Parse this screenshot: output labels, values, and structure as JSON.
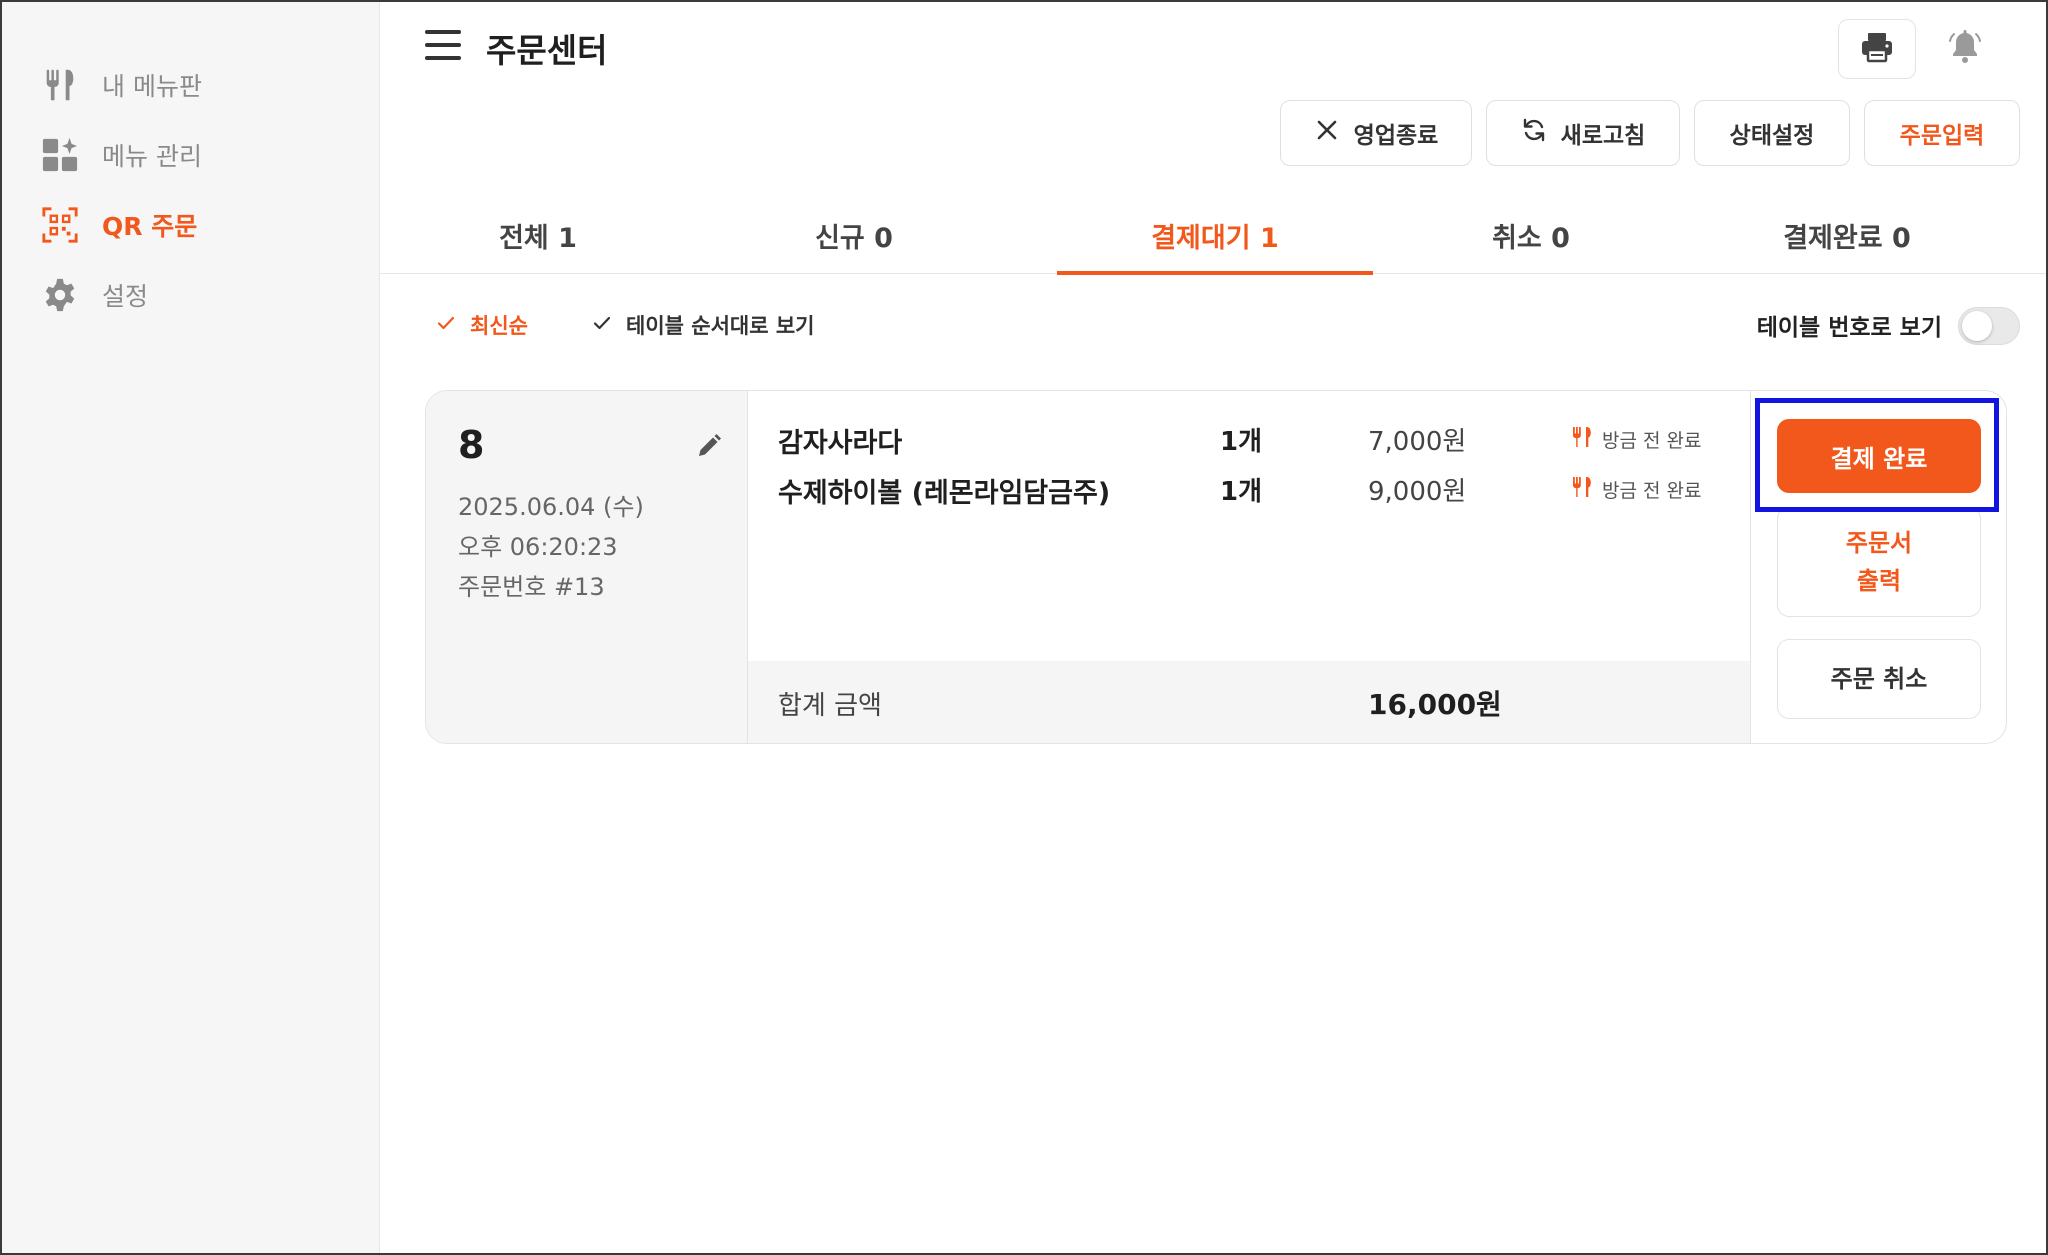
{
  "sidebar": {
    "items": [
      {
        "label": "내 메뉴판",
        "icon": "utensils-icon",
        "active": false
      },
      {
        "label": "메뉴 관리",
        "icon": "grid-sparkle-icon",
        "active": false
      },
      {
        "label": "QR 주문",
        "icon": "qr-scan-icon",
        "active": true
      },
      {
        "label": "설정",
        "icon": "gear-icon",
        "active": false
      }
    ]
  },
  "header": {
    "title": "주문센터",
    "menu_icon": "hamburger-icon",
    "print_icon": "printer-icon",
    "bell_icon": "bell-icon"
  },
  "actions": {
    "close_label": "영업종료",
    "refresh_label": "새로고침",
    "status_label": "상태설정",
    "order_input_label": "주문입력"
  },
  "tabs": [
    {
      "label": "전체 1",
      "active": false
    },
    {
      "label": "신규 0",
      "active": false
    },
    {
      "label": "결제대기 1",
      "active": true
    },
    {
      "label": "취소 0",
      "active": false
    },
    {
      "label": "결제완료 0",
      "active": false
    }
  ],
  "filters": {
    "latest": "최신순",
    "table_order": "테이블 순서대로 보기",
    "table_number_view": "테이블 번호로 보기"
  },
  "order": {
    "table_no": "8",
    "date": "2025.06.04 (수)",
    "time": "오후 06:20:23",
    "order_no": "주문번호 #13",
    "items": [
      {
        "name": "감자사라다",
        "qty": "1개",
        "price": "7,000원",
        "status": "방금 전 완료"
      },
      {
        "name": "수제하이볼 (레몬라임담금주)",
        "qty": "1개",
        "price": "9,000원",
        "status": "방금 전 완료"
      }
    ],
    "total_label": "합계 금액",
    "total_value": "16,000원",
    "pay_complete_label": "결제 완료",
    "print_label_line1": "주문서",
    "print_label_line2": "출력",
    "cancel_label": "주문 취소"
  },
  "colors": {
    "accent": "#f2571b",
    "highlight": "#1414e0",
    "sidebar_bg": "#f6f6f6"
  }
}
